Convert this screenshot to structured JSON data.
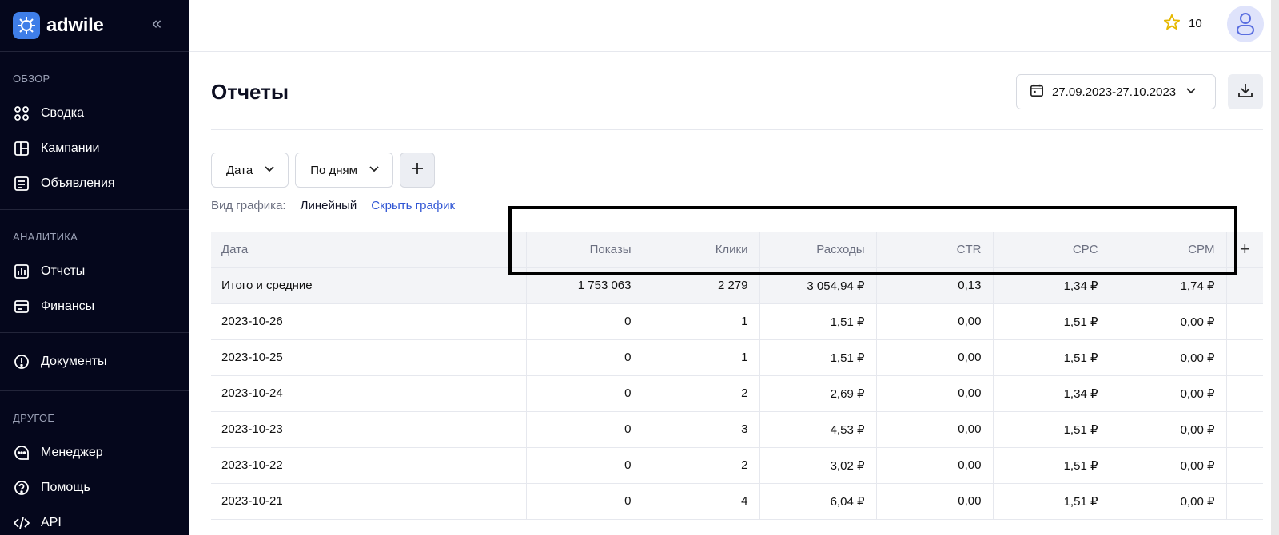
{
  "brand": {
    "name": "adwile"
  },
  "sidebar": {
    "sections": [
      {
        "title": "ОБЗОР",
        "items": [
          {
            "label": "Сводка",
            "icon": "grid-icon"
          },
          {
            "label": "Кампании",
            "icon": "layout-icon"
          },
          {
            "label": "Объявления",
            "icon": "document-icon"
          }
        ]
      },
      {
        "title": "АНАЛИТИКА",
        "items": [
          {
            "label": "Отчеты",
            "icon": "chart-icon"
          },
          {
            "label": "Финансы",
            "icon": "wallet-icon"
          }
        ]
      },
      {
        "title": "",
        "items": [
          {
            "label": "Документы",
            "icon": "info-icon"
          }
        ]
      },
      {
        "title": "ДРУГОЕ",
        "items": [
          {
            "label": "Менеджер",
            "icon": "chat-icon"
          },
          {
            "label": "Помощь",
            "icon": "help-icon"
          },
          {
            "label": "API",
            "icon": "code-icon"
          }
        ]
      }
    ]
  },
  "topbar": {
    "star_count": "10"
  },
  "page": {
    "title": "Отчеты",
    "date_range": "27.09.2023-27.10.2023"
  },
  "filters": {
    "date_label": "Дата",
    "group_label": "По дням"
  },
  "chart_controls": {
    "label": "Вид графика:",
    "type": "Линейный",
    "hide": "Скрыть график"
  },
  "table": {
    "headers": [
      "Дата",
      "Показы",
      "Клики",
      "Расходы",
      "CTR",
      "CPC",
      "CPM"
    ],
    "total": [
      "Итого и средние",
      "1 753 063",
      "2 279",
      "3 054,94 ₽",
      "0,13",
      "1,34 ₽",
      "1,74 ₽"
    ],
    "rows": [
      [
        "2023-10-26",
        "0",
        "1",
        "1,51 ₽",
        "0,00",
        "1,51 ₽",
        "0,00 ₽"
      ],
      [
        "2023-10-25",
        "0",
        "1",
        "1,51 ₽",
        "0,00",
        "1,51 ₽",
        "0,00 ₽"
      ],
      [
        "2023-10-24",
        "0",
        "2",
        "2,69 ₽",
        "0,00",
        "1,34 ₽",
        "0,00 ₽"
      ],
      [
        "2023-10-23",
        "0",
        "3",
        "4,53 ₽",
        "0,00",
        "1,51 ₽",
        "0,00 ₽"
      ],
      [
        "2023-10-22",
        "0",
        "2",
        "3,02 ₽",
        "0,00",
        "1,51 ₽",
        "0,00 ₽"
      ],
      [
        "2023-10-21",
        "0",
        "4",
        "6,04 ₽",
        "0,00",
        "1,51 ₽",
        "0,00 ₽"
      ]
    ]
  },
  "colors": {
    "sidebar_bg": "#05071c",
    "accent": "#3f7ee8",
    "link": "#2f55d4",
    "highlight": "#000000"
  }
}
